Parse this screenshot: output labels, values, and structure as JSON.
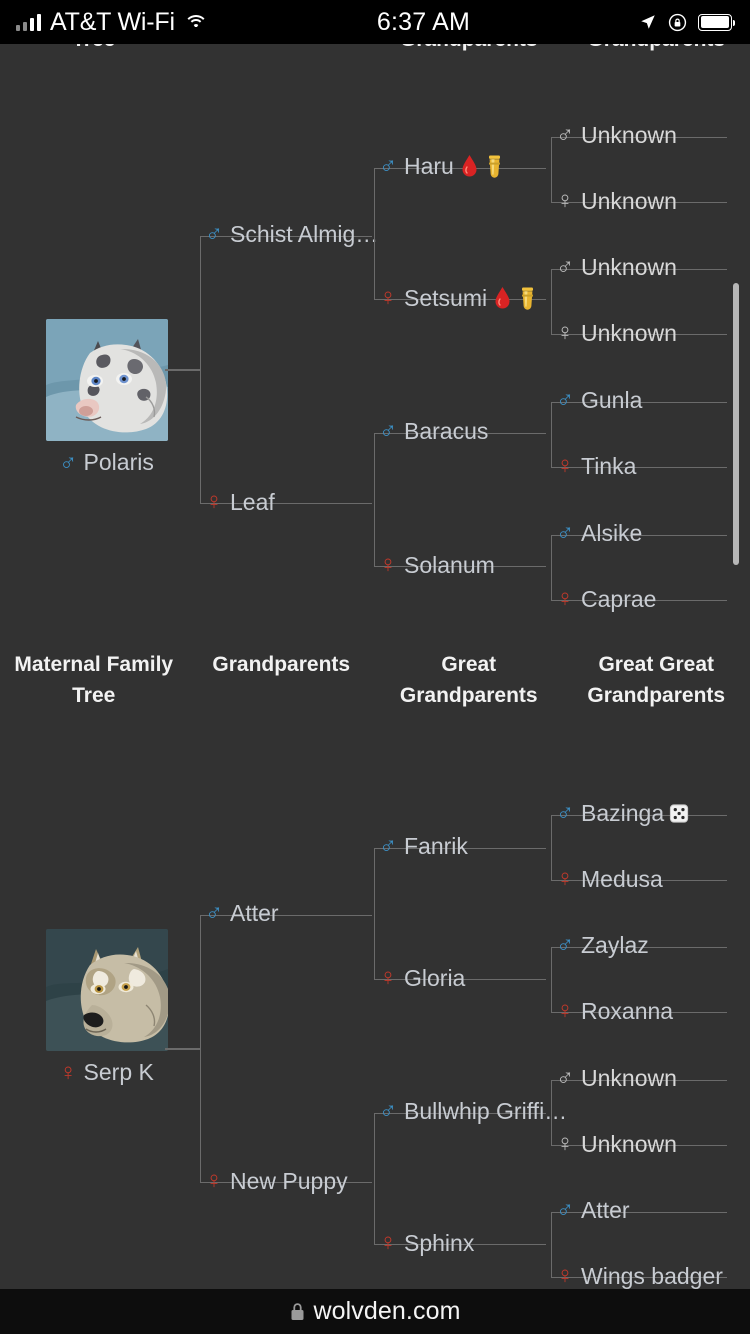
{
  "statusbar": {
    "carrier": "AT&T Wi-Fi",
    "time": "6:37 AM",
    "signal_icon": "signal-bars-icon",
    "wifi_icon": "wifi-icon",
    "location_icon": "location-arrow-icon",
    "rotation_lock_icon": "rotation-lock-icon",
    "battery_icon": "battery-icon"
  },
  "browser": {
    "lock_icon": "lock-icon",
    "host": "wolvden.com"
  },
  "colors": {
    "page_bg": "#323232",
    "male": "#3c8fc4",
    "female": "#c0392b",
    "unknown": "#b9b9b9",
    "name_text": "#c8ccd2",
    "bracket_line": "#6b6b6b",
    "header_text": "#f2f2f2",
    "scrollbar": "#b7b7b7"
  },
  "paternal": {
    "headers": [
      "Tree",
      "",
      "Grandparents",
      "Grandparents"
    ],
    "root": {
      "name": "Polaris",
      "sex": "male",
      "portrait": "wolf-portrait-polaris"
    },
    "parents": [
      {
        "name": "Schist Almig…",
        "sex": "male"
      },
      {
        "name": "Leaf",
        "sex": "female"
      }
    ],
    "grandparents": [
      {
        "name": "Haru",
        "sex": "male",
        "badges": [
          "blood-drop-icon",
          "urn-icon"
        ]
      },
      {
        "name": "Setsumi",
        "sex": "female",
        "badges": [
          "blood-drop-icon",
          "urn-icon"
        ]
      },
      {
        "name": "Baracus",
        "sex": "male",
        "badges": []
      },
      {
        "name": "Solanum",
        "sex": "female",
        "badges": []
      }
    ],
    "great_grandparents": [
      {
        "name": "Unknown",
        "sex": "unknown-male"
      },
      {
        "name": "Unknown",
        "sex": "unknown-female"
      },
      {
        "name": "Unknown",
        "sex": "unknown-male"
      },
      {
        "name": "Unknown",
        "sex": "unknown-female"
      },
      {
        "name": "Gunla",
        "sex": "male"
      },
      {
        "name": "Tinka",
        "sex": "female"
      },
      {
        "name": "Alsike",
        "sex": "male"
      },
      {
        "name": "Caprae",
        "sex": "female"
      }
    ]
  },
  "maternal": {
    "headers": [
      "Maternal Family Tree",
      "Grandparents",
      "Great Grandparents",
      "Great Great Grandparents"
    ],
    "root": {
      "name": "Serp K",
      "sex": "female",
      "portrait": "wolf-portrait-serp-k"
    },
    "parents": [
      {
        "name": "Atter",
        "sex": "male"
      },
      {
        "name": "New Puppy",
        "sex": "female"
      }
    ],
    "grandparents": [
      {
        "name": "Fanrik",
        "sex": "male",
        "badges": []
      },
      {
        "name": "Gloria",
        "sex": "female",
        "badges": []
      },
      {
        "name": "Bullwhip Griffi…",
        "sex": "male",
        "badges": []
      },
      {
        "name": "Sphinx",
        "sex": "female",
        "badges": []
      }
    ],
    "great_grandparents": [
      {
        "name": "Bazinga",
        "sex": "male",
        "badges": [
          "die-icon"
        ]
      },
      {
        "name": "Medusa",
        "sex": "female",
        "badges": []
      },
      {
        "name": "Zaylaz",
        "sex": "male",
        "badges": []
      },
      {
        "name": "Roxanna",
        "sex": "female",
        "badges": []
      },
      {
        "name": "Unknown",
        "sex": "unknown-male",
        "badges": []
      },
      {
        "name": "Unknown",
        "sex": "unknown-female",
        "badges": []
      },
      {
        "name": "Atter",
        "sex": "male",
        "badges": []
      },
      {
        "name": "Wings badger",
        "sex": "female",
        "badges": []
      }
    ]
  }
}
